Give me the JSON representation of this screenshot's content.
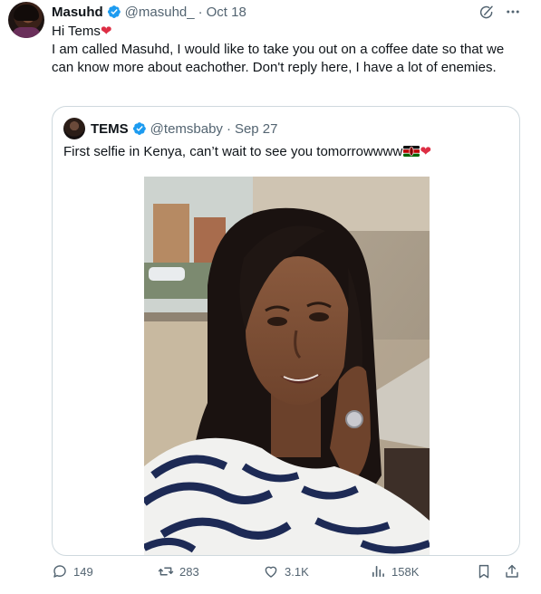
{
  "tweet": {
    "author": {
      "name": "Masuhd",
      "handle": "@masuhd_",
      "separator": "·",
      "date": "Oct 18"
    },
    "text": {
      "line1": "Hi Tems",
      "line1_emoji": "❤",
      "line2": "I am called Masuhd, I would like to take you  out on a  coffee date  so that we can know more about eachother. Don't reply here, I have a lot of enemies."
    }
  },
  "quote": {
    "author": {
      "name": "TEMS",
      "handle": "@temsbaby",
      "separator": "·",
      "date": "Sep 27"
    },
    "text": "First selfie in Kenya, can’t wait to see you tomorrowwww",
    "text_emoji_heart": "❤",
    "flag_icon": "kenya-flag-icon",
    "photo_icon": "selfie-photo"
  },
  "actions": {
    "replies": "149",
    "reposts": "283",
    "likes": "3.1K",
    "views": "158K"
  },
  "colors": {
    "text_primary": "#0f1419",
    "text_secondary": "#536471",
    "border": "#cfd9de",
    "verified_blue": "#1d9bf0",
    "heart_red": "#dd2e44"
  }
}
